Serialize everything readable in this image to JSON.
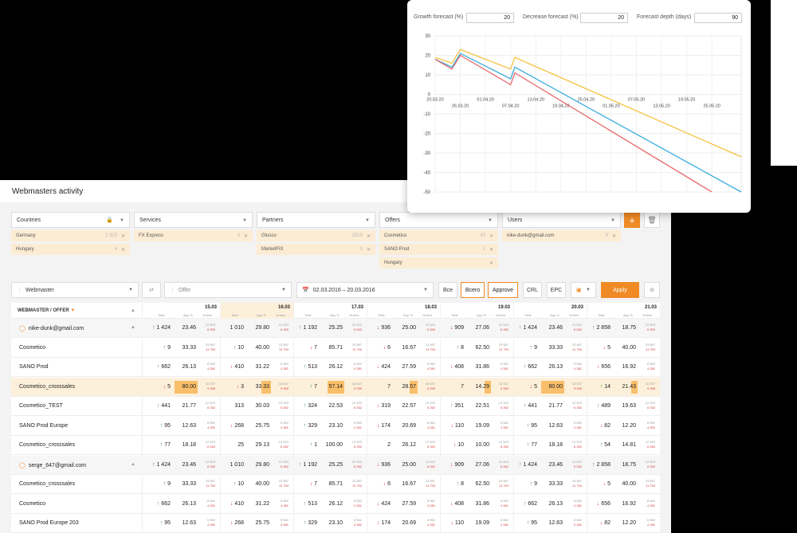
{
  "page_title": "Webmasters activity",
  "filters": [
    {
      "label": "Countries",
      "icon": "lock-icon",
      "chips": [
        {
          "name": "Germany",
          "count": "2 325"
        },
        {
          "name": "Hungary",
          "count": "4"
        }
      ]
    },
    {
      "label": "Services",
      "chips": [
        {
          "name": "FX Express",
          "count": "4"
        }
      ]
    },
    {
      "label": "Partners",
      "chips": [
        {
          "name": "Glusco",
          "count": "2519"
        },
        {
          "name": "MarketFIX",
          "count": "3"
        }
      ]
    },
    {
      "label": "Offers",
      "chips": [
        {
          "name": "Cosmetico",
          "count": "43"
        },
        {
          "name": "SANO Prod",
          "count": "2"
        },
        {
          "name": "Hungary",
          "count": ""
        }
      ]
    },
    {
      "label": "Users",
      "chips": [
        {
          "name": "nike-dunk@gmail.com",
          "count": "9"
        }
      ]
    }
  ],
  "toolbar": {
    "group_by": "Webmaster",
    "offer_placeholder": "Offer",
    "date_range": "02.03.2016 – 20.03.2016",
    "btn_all_lower": "Все",
    "btn_all": "Всего",
    "btn_approve": "Approve",
    "btn_crl": "CRL",
    "btn_epc": "EPC",
    "btn_apply": "Apply"
  },
  "table": {
    "first_col_header": "WEBMASTER / OFFER",
    "sub_labels": {
      "total": "Total",
      "app": "App %",
      "orders": "Orders"
    },
    "dates": [
      "15.03",
      "16.03",
      "17.03",
      "18.03",
      "19.03",
      "20.03",
      "21.03"
    ],
    "rows": [
      {
        "type": "group",
        "name": "nike-dunk@gmail.com",
        "cells": [
          [
            "↑",
            "1 424",
            "23.46",
            "12 523",
            "6 262"
          ],
          [
            "",
            "1 010",
            "29.80",
            "12 523",
            "6 262"
          ],
          [
            "↑",
            "1 192",
            "25.25",
            "12 523",
            "6 262"
          ],
          [
            "↓",
            "936",
            "25.00",
            "12 523",
            "6 262"
          ],
          [
            "↓",
            "909",
            "27.06",
            "12 523",
            "6 262"
          ],
          [
            "↑",
            "1 424",
            "23.46",
            "12 523",
            "6 262"
          ],
          [
            "↑",
            "2 858",
            "18.75",
            "12 523",
            "6 262"
          ]
        ]
      },
      {
        "type": "item",
        "name": "Cosmetico",
        "cells": [
          [
            "↑",
            "9",
            "33.33",
            "23 587",
            "11 794"
          ],
          [
            "↑",
            "10",
            "40.00",
            "23 587",
            "11 794"
          ],
          [
            "↓",
            "7",
            "85.71",
            "23 587",
            "11 794"
          ],
          [
            "↓",
            "6",
            "16.67",
            "23 587",
            "11 794"
          ],
          [
            "↑",
            "8",
            "62.50",
            "23 587",
            "11 794"
          ],
          [
            "↑",
            "9",
            "33.33",
            "23 587",
            "11 794"
          ],
          [
            "↓",
            "5",
            "40.00",
            "23 587",
            "11 794"
          ]
        ]
      },
      {
        "type": "item",
        "name": "SANO Prod",
        "cells": [
          [
            "↑",
            "662",
            "26.13",
            "8 562",
            "4 281"
          ],
          [
            "↓",
            "410",
            "31.22",
            "8 562",
            "4 281"
          ],
          [
            "↑",
            "513",
            "26.12",
            "8 562",
            "4 281"
          ],
          [
            "↓",
            "424",
            "27.59",
            "8 562",
            "4 281"
          ],
          [
            "↓",
            "408",
            "31.86",
            "8 562",
            "4 281"
          ],
          [
            "↑",
            "662",
            "26.13",
            "8 562",
            "4 281"
          ],
          [
            "↓",
            "656",
            "16.92",
            "8 562",
            "4 281"
          ]
        ]
      },
      {
        "type": "highlight",
        "name": "Cosmetico_crosssales",
        "cells": [
          [
            "↓",
            "5",
            "80.00",
            "18 537",
            "9 269"
          ],
          [
            "↓",
            "3",
            "33.33",
            "18 537",
            "9 269"
          ],
          [
            "↑",
            "7",
            "57.14",
            "18 537",
            "9 269"
          ],
          [
            "",
            "7",
            "28.57",
            "18 537",
            "9 269"
          ],
          [
            "",
            "7",
            "14.29",
            "18 537",
            "9 269"
          ],
          [
            "↓",
            "5",
            "80.00",
            "18 537",
            "9 269"
          ],
          [
            "↑",
            "14",
            "21.43",
            "18 537",
            "9 269"
          ]
        ]
      },
      {
        "type": "item",
        "name": "Cosmetico_TEST",
        "cells": [
          [
            "↑",
            "441",
            "21.77",
            "12 523",
            "6 262"
          ],
          [
            "",
            "313",
            "30.03",
            "12 523",
            "6 262"
          ],
          [
            "↑",
            "324",
            "22.53",
            "12 523",
            "6 262"
          ],
          [
            "↓",
            "319",
            "22.57",
            "12 523",
            "6 262"
          ],
          [
            "↑",
            "351",
            "22.51",
            "12 523",
            "6 262"
          ],
          [
            "↑",
            "441",
            "21.77",
            "12 523",
            "6 262"
          ],
          [
            "↑",
            "489",
            "19.63",
            "12 523",
            "6 262"
          ]
        ]
      },
      {
        "type": "item",
        "name": "SANO Prod Europe",
        "cells": [
          [
            "↑",
            "95",
            "12.63",
            "8 562",
            "4 281"
          ],
          [
            "↓",
            "268",
            "25.75",
            "8 562",
            "4 281"
          ],
          [
            "↑",
            "329",
            "23.10",
            "8 562",
            "4 281"
          ],
          [
            "↓",
            "174",
            "20.69",
            "8 562",
            "4 281"
          ],
          [
            "↓",
            "110",
            "19.09",
            "8 562",
            "4 281"
          ],
          [
            "↑",
            "95",
            "12.63",
            "8 562",
            "4 281"
          ],
          [
            "↓",
            "82",
            "12.20",
            "8 562",
            "4 281"
          ]
        ]
      },
      {
        "type": "item",
        "name": "Cosmetico_crosssales",
        "cells": [
          [
            "↑",
            "77",
            "18.18",
            "12 523",
            "6 262"
          ],
          [
            "",
            "25",
            "29.13",
            "12 523",
            "6 262"
          ],
          [
            "↑",
            "1",
            "100.00",
            "12 523",
            "6 262"
          ],
          [
            "",
            "2",
            "26.12",
            "12 523",
            "6 262"
          ],
          [
            "↓",
            "10",
            "10.00",
            "12 523",
            "6 262"
          ],
          [
            "↑",
            "77",
            "18.18",
            "12 523",
            "6 262"
          ],
          [
            "↑",
            "54",
            "14.81",
            "12 523",
            "6 262"
          ]
        ]
      },
      {
        "type": "group",
        "name": "serge_647@gmail.com",
        "cells": [
          [
            "↑",
            "1 424",
            "23.46",
            "12 523",
            "6 262"
          ],
          [
            "",
            "1 010",
            "29.80",
            "12 523",
            "6 262"
          ],
          [
            "↑",
            "1 192",
            "25.25",
            "12 523",
            "6 262"
          ],
          [
            "↓",
            "936",
            "25.00",
            "12 523",
            "6 262"
          ],
          [
            "↓",
            "909",
            "27.06",
            "12 523",
            "6 262"
          ],
          [
            "↑",
            "1 424",
            "23.46",
            "12 523",
            "6 262"
          ],
          [
            "↑",
            "2 858",
            "18.75",
            "12 523",
            "6 262"
          ]
        ]
      },
      {
        "type": "item",
        "name": "Cosmetico_crosssales",
        "cells": [
          [
            "↑",
            "9",
            "33.33",
            "23 587",
            "11 794"
          ],
          [
            "↑",
            "10",
            "40.00",
            "23 587",
            "11 794"
          ],
          [
            "↓",
            "7",
            "85.71",
            "23 587",
            "11 794"
          ],
          [
            "↓",
            "6",
            "16.67",
            "23 587",
            "11 794"
          ],
          [
            "↑",
            "8",
            "62.50",
            "23 587",
            "11 794"
          ],
          [
            "↑",
            "9",
            "33.33",
            "23 587",
            "11 794"
          ],
          [
            "↓",
            "5",
            "40.00",
            "23 587",
            "11 794"
          ]
        ]
      },
      {
        "type": "item",
        "name": "Cosmetico",
        "cells": [
          [
            "↑",
            "662",
            "26.13",
            "8 562",
            "4 281"
          ],
          [
            "↓",
            "410",
            "31.22",
            "8 562",
            "4 281"
          ],
          [
            "↑",
            "513",
            "26.12",
            "8 562",
            "4 281"
          ],
          [
            "↓",
            "424",
            "27.59",
            "8 562",
            "4 281"
          ],
          [
            "↓",
            "408",
            "31.86",
            "8 562",
            "4 281"
          ],
          [
            "↑",
            "662",
            "26.13",
            "8 562",
            "4 281"
          ],
          [
            "↓",
            "656",
            "16.92",
            "8 562",
            "4 281"
          ]
        ]
      },
      {
        "type": "item",
        "name": "SANO Prod Europe 203",
        "cells": [
          [
            "↑",
            "95",
            "12.63",
            "8 562",
            "4 281"
          ],
          [
            "↓",
            "268",
            "25.75",
            "8 562",
            "4 281"
          ],
          [
            "↑",
            "329",
            "23.10",
            "8 562",
            "4 281"
          ],
          [
            "↓",
            "174",
            "20.69",
            "8 562",
            "4 281"
          ],
          [
            "↓",
            "110",
            "19.09",
            "8 562",
            "4 281"
          ],
          [
            "↑",
            "95",
            "12.63",
            "8 562",
            "4 281"
          ],
          [
            "↓",
            "82",
            "12.20",
            "8 562",
            "4 281"
          ]
        ]
      }
    ]
  },
  "forecast": {
    "growth_label": "Growth forecast (%)",
    "growth_value": "20",
    "decrease_label": "Decrease forecast (%)",
    "decrease_value": "20",
    "depth_label": "Forecast depth (days)",
    "depth_value": "90"
  },
  "chart_data": {
    "type": "line",
    "ylim": [
      -50,
      30
    ],
    "yticks": [
      30,
      20,
      10,
      0,
      -10,
      -20,
      -30,
      -40,
      -50
    ],
    "xlim": [
      "2020-03-20",
      "2020-06-01"
    ],
    "xticks_upper": [
      "20.03.20",
      "01.04.20",
      "13.04.20",
      "25.04.20",
      "07.05.20",
      "19.05.20"
    ],
    "xticks_lower": [
      "26.03.20",
      "07.04.20",
      "19.04.20",
      "01.05.20",
      "13.05.20",
      "25.05.20"
    ],
    "grid": true,
    "series": [
      {
        "color": "#f5c242",
        "x": [
          "2020-03-20",
          "2020-03-24",
          "2020-03-26",
          "2020-04-07",
          "2020-04-08",
          "2020-06-01"
        ],
        "y": [
          19,
          16,
          23,
          13,
          19,
          -32
        ]
      },
      {
        "color": "#3aaee0",
        "x": [
          "2020-03-20",
          "2020-03-24",
          "2020-03-26",
          "2020-04-07",
          "2020-04-08",
          "2020-06-01"
        ],
        "y": [
          18,
          14,
          21,
          8,
          14,
          -50
        ]
      },
      {
        "color": "#e86c6c",
        "x": [
          "2020-03-20",
          "2020-03-24",
          "2020-03-26",
          "2020-04-07",
          "2020-04-08",
          "2020-05-25"
        ],
        "y": [
          18,
          13,
          20,
          5,
          11,
          -50
        ]
      }
    ]
  }
}
